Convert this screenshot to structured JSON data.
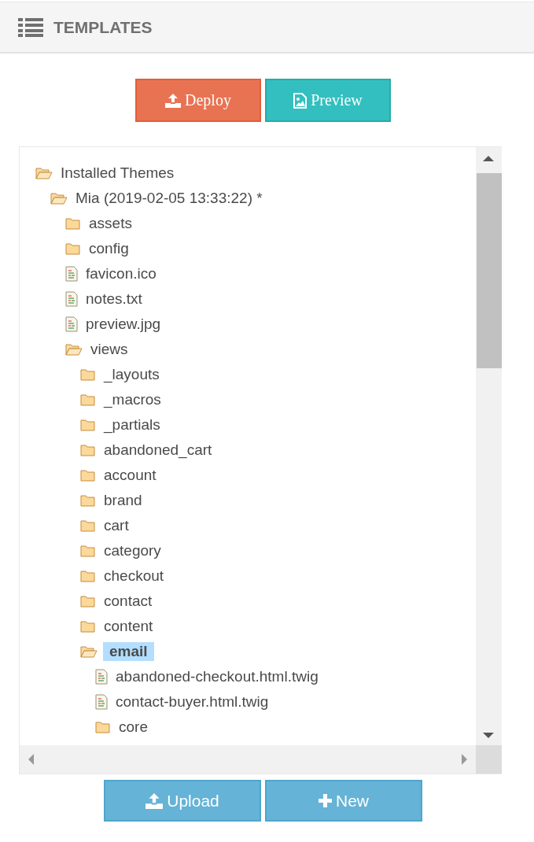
{
  "header": {
    "title": "TEMPLATES"
  },
  "top_buttons": [
    {
      "kind": "deploy",
      "label": "Deploy"
    },
    {
      "kind": "preview",
      "label": "Preview"
    }
  ],
  "tree": [
    {
      "kind": "folder",
      "label": "Installed Themes",
      "expanded": true,
      "selected": false,
      "children": [
        {
          "kind": "folder",
          "label": "Mia (2019-02-05 13:33:22) *",
          "expanded": true,
          "selected": false,
          "children": [
            {
              "kind": "folder",
              "label": "assets",
              "expanded": false,
              "selected": false
            },
            {
              "kind": "folder",
              "label": "config",
              "expanded": false,
              "selected": false
            },
            {
              "kind": "file",
              "label": "favicon.ico",
              "selected": false
            },
            {
              "kind": "file",
              "label": "notes.txt",
              "selected": false
            },
            {
              "kind": "file",
              "label": "preview.jpg",
              "selected": false
            },
            {
              "kind": "folder",
              "label": "views",
              "expanded": true,
              "selected": false,
              "children": [
                {
                  "kind": "folder",
                  "label": "_layouts",
                  "expanded": false,
                  "selected": false
                },
                {
                  "kind": "folder",
                  "label": "_macros",
                  "expanded": false,
                  "selected": false
                },
                {
                  "kind": "folder",
                  "label": "_partials",
                  "expanded": false,
                  "selected": false
                },
                {
                  "kind": "folder",
                  "label": "abandoned_cart",
                  "expanded": false,
                  "selected": false
                },
                {
                  "kind": "folder",
                  "label": "account",
                  "expanded": false,
                  "selected": false
                },
                {
                  "kind": "folder",
                  "label": "brand",
                  "expanded": false,
                  "selected": false
                },
                {
                  "kind": "folder",
                  "label": "cart",
                  "expanded": false,
                  "selected": false
                },
                {
                  "kind": "folder",
                  "label": "category",
                  "expanded": false,
                  "selected": false
                },
                {
                  "kind": "folder",
                  "label": "checkout",
                  "expanded": false,
                  "selected": false
                },
                {
                  "kind": "folder",
                  "label": "contact",
                  "expanded": false,
                  "selected": false
                },
                {
                  "kind": "folder",
                  "label": "content",
                  "expanded": false,
                  "selected": false
                },
                {
                  "kind": "folder",
                  "label": "email",
                  "expanded": true,
                  "selected": true,
                  "children": [
                    {
                      "kind": "file",
                      "label": "abandoned-checkout.html.twig",
                      "selected": false
                    },
                    {
                      "kind": "file",
                      "label": "contact-buyer.html.twig",
                      "selected": false
                    },
                    {
                      "kind": "folder",
                      "label": "core",
                      "expanded": false,
                      "selected": false
                    }
                  ]
                }
              ]
            }
          ]
        }
      ]
    }
  ],
  "bottom_buttons": [
    {
      "kind": "upload",
      "label": "Upload"
    },
    {
      "kind": "new",
      "label": "New"
    }
  ]
}
